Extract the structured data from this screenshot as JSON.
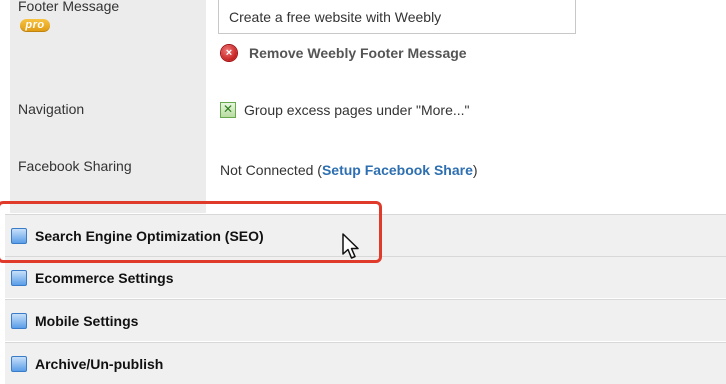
{
  "settings": {
    "footer_message": {
      "label": "Footer Message",
      "badge": "pro",
      "input_value": "Create a free website with Weebly",
      "remove_label": "Remove Weebly Footer Message"
    },
    "navigation": {
      "label": "Navigation",
      "checked": true,
      "option_label": "Group excess pages under \"More...\""
    },
    "facebook_sharing": {
      "label": "Facebook Sharing",
      "status_prefix": "Not Connected (",
      "link_label": "Setup Facebook Share",
      "status_suffix": ")"
    }
  },
  "sections": [
    {
      "title": "Search Engine Optimization (SEO)",
      "highlighted": true
    },
    {
      "title": "Ecommerce Settings"
    },
    {
      "title": "Mobile Settings"
    },
    {
      "title": "Archive/Un-publish"
    }
  ],
  "colors": {
    "highlight": "#e03a2a",
    "link": "#2d6fb0",
    "label_bg": "#ececec",
    "section_bg": "#f0f0f0"
  },
  "icons": {
    "remove": "remove-circle-icon",
    "checkbox": "checkbox-checked-icon",
    "section": "section-folder-icon",
    "cursor": "mouse-pointer-icon"
  }
}
